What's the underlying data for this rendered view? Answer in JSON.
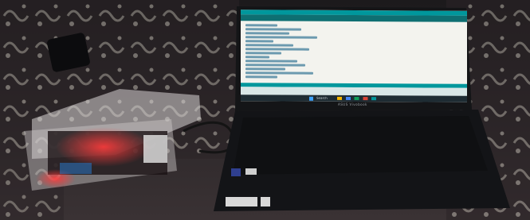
{
  "scene": {
    "subject": "laptop running an IDE connected by USB cable to a microcontroller board inside a clear plastic enclosure on a patterned carpet",
    "colors": {
      "carpet_dark": "#2a2326",
      "carpet_light": "#b7b1a8",
      "ide_teal": "#00979c",
      "ide_toolbar": "#0e6f72",
      "screen_bg": "#f3f3ee",
      "taskbar": "#1e2c33",
      "laptop_body": "#131417",
      "enclosure": "#d9d6d6",
      "board_red_glow": "#ff2a2a",
      "cable": "#141414"
    }
  },
  "laptop": {
    "bezel_text": "ASUS Vivobook",
    "ide": {
      "code_lines": 14
    },
    "taskbar": {
      "search": "Search"
    },
    "keyboard_strip_label": "",
    "sticker_labels": [
      "",
      ""
    ]
  }
}
